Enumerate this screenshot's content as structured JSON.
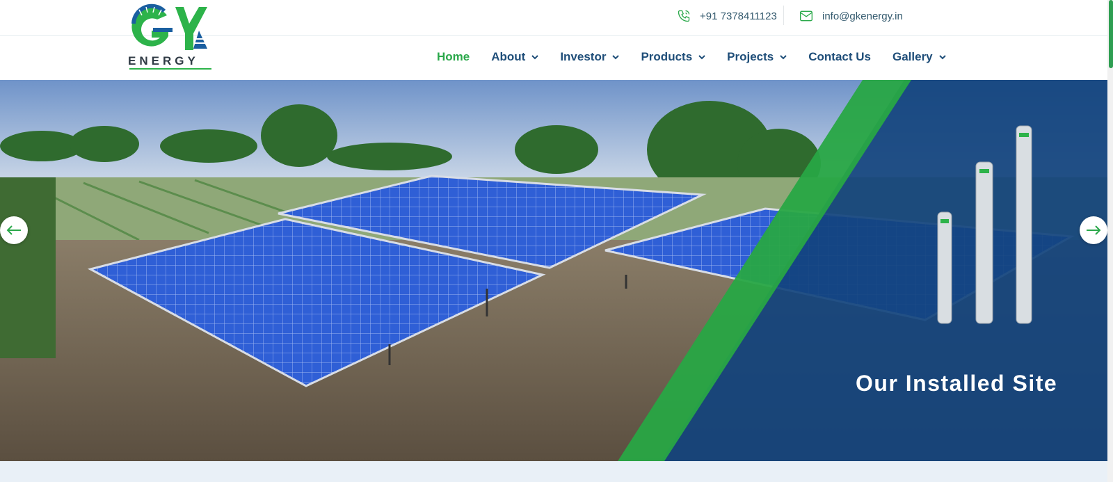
{
  "header": {
    "logo_text": "ENERGY",
    "logo_letters": "GK",
    "phone": "+91 7378411123",
    "email": "info@gkenergy.in"
  },
  "nav": {
    "items": [
      {
        "label": "Home",
        "dropdown": false,
        "active": true
      },
      {
        "label": "About",
        "dropdown": true
      },
      {
        "label": "Investor",
        "dropdown": true
      },
      {
        "label": "Products",
        "dropdown": true
      },
      {
        "label": "Projects",
        "dropdown": true
      },
      {
        "label": "Contact Us",
        "dropdown": false
      },
      {
        "label": "Gallery",
        "dropdown": true
      }
    ]
  },
  "hero": {
    "slide_title": "Our Installed Site",
    "prev_icon": "arrow-left-icon",
    "next_icon": "arrow-right-icon"
  },
  "colors": {
    "brand_green": "#2aa84a",
    "brand_blue": "#1f4e79",
    "overlay_blue": "#12437d"
  }
}
